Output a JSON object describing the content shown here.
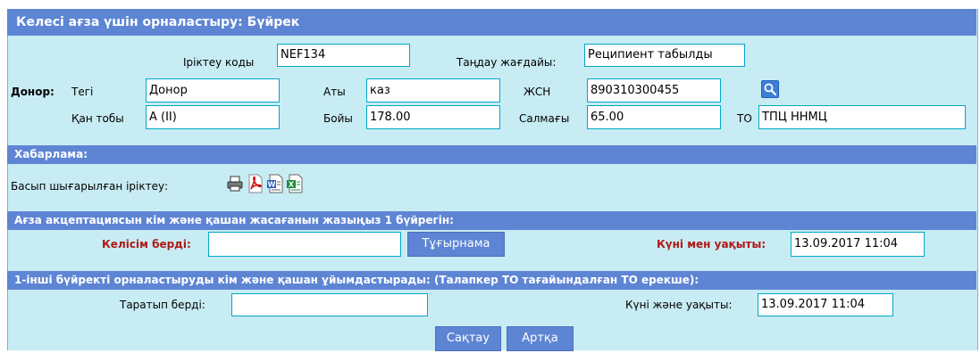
{
  "header": {
    "title": "Келесі ағза үшін орналастыру: Бүйрек"
  },
  "selection": {
    "code_label": "Іріктеу коды",
    "code_value": "NEF134",
    "status_label": "Таңдау жағдайы:",
    "status_value": "Реципиент табылды"
  },
  "donor": {
    "donor_label": "Донор:",
    "surname_label": "Тегі",
    "surname_value": "Донор",
    "name_label": "Аты",
    "name_value": "каз",
    "iin_label": "ЖСН",
    "iin_value": "890310300455",
    "blood_label": "Қан тобы",
    "blood_value": "A (II)",
    "height_label": "Бойы",
    "height_value": "178.00",
    "weight_label": "Салмағы",
    "weight_value": "65.00",
    "to_label": "ТО",
    "to_value": "ТПЦ ННМЦ"
  },
  "message": {
    "section_title": "Хабарлама:",
    "printed_label": "Басып шығарылған іріктеу:",
    "icons": [
      "printer-icon",
      "pdf-icon",
      "word-icon",
      "excel-icon"
    ]
  },
  "acceptance": {
    "section_title": "Ағза акцептациясын кім және қашан жасағанын жазыңыз 1 бүйрегін:",
    "agreed_label": "Келісім берді:",
    "agreed_value": "",
    "confirm_button": "Тұғырнама",
    "datetime_label": "Күні мен уақыты:",
    "datetime_value": "13.09.2017 11:04"
  },
  "distribution": {
    "section_title": "1-інші бүйректі орналастыруды кім және қашан ұйымдастырады: (Талапкер ТО тағайындалған ТО ерекше):",
    "distributed_label": "Таратып берді:",
    "distributed_value": "",
    "datetime_label": "Күні және уақыты:",
    "datetime_value": "13.09.2017 11:04"
  },
  "actions": {
    "save": "Сақтау",
    "back": "Артқа"
  },
  "colors": {
    "panel": "#c8ecf3",
    "bar": "#5e85d4",
    "field_border": "#00a8c8",
    "accent_red": "#b01818"
  }
}
